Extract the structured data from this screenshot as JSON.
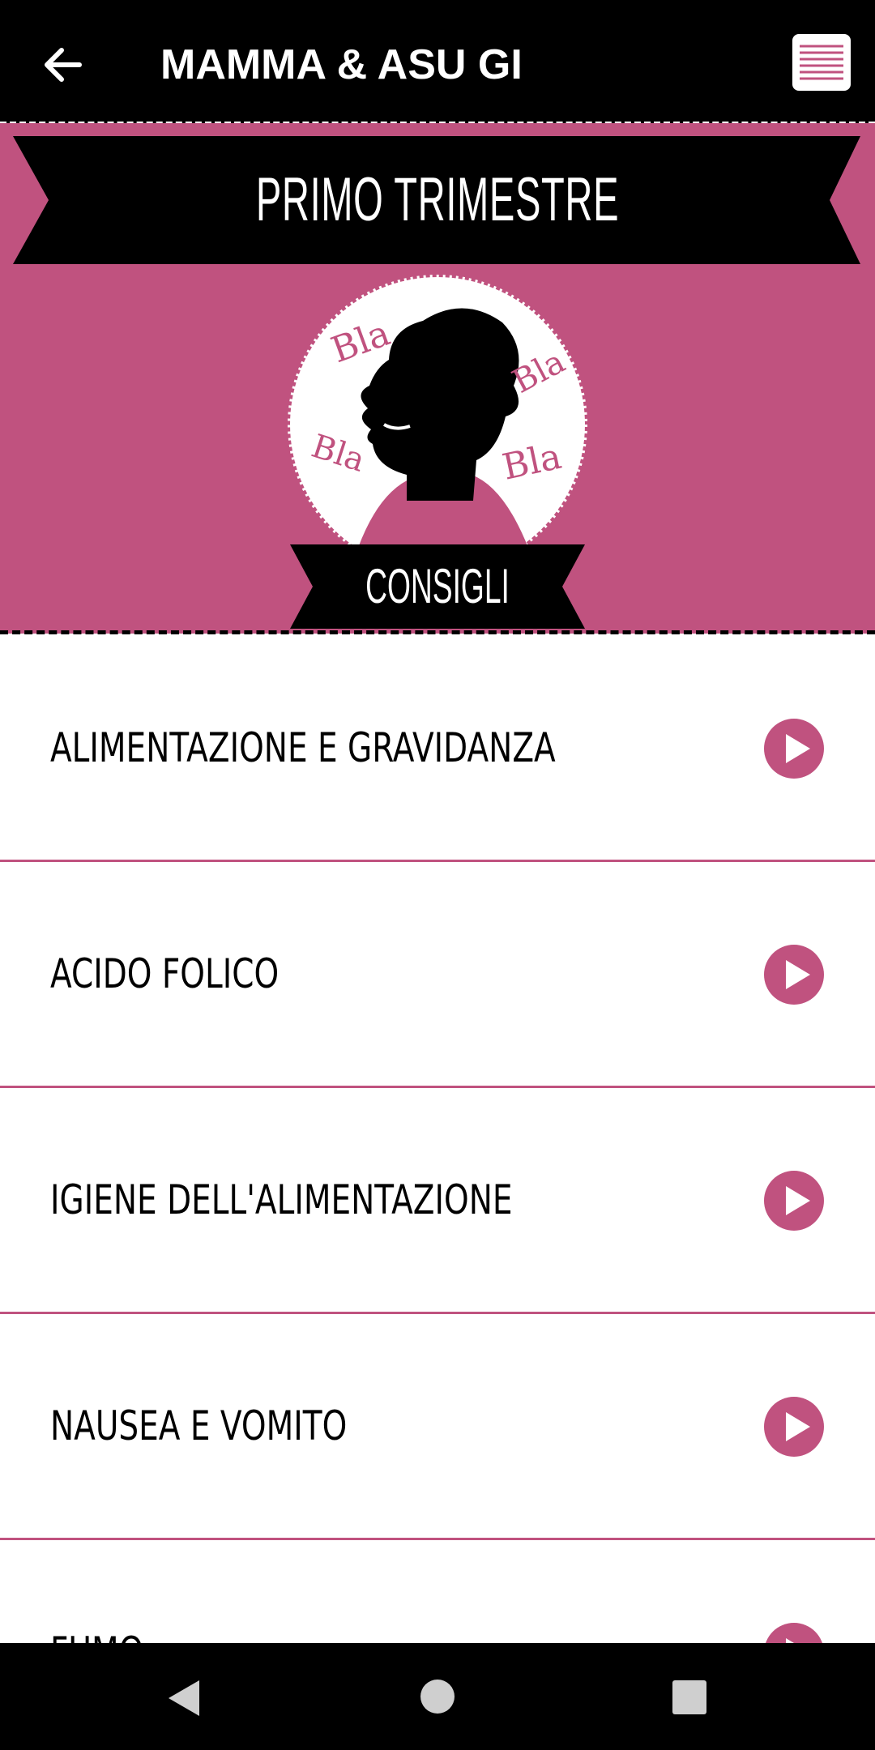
{
  "appbar": {
    "title": "MAMMA & ASU GI",
    "back_icon": "arrow-left-icon",
    "menu_icon": "menu-lines-icon"
  },
  "header": {
    "title": "PRIMO TRIMESTRE",
    "section_label": "CONSIGLI",
    "bubble_words": [
      "Bla",
      "Bla",
      "Bla",
      "Bla"
    ]
  },
  "list": {
    "items": [
      {
        "label": "ALIMENTAZIONE E GRAVIDANZA",
        "icon": "play-icon"
      },
      {
        "label": "ACIDO FOLICO",
        "icon": "play-icon"
      },
      {
        "label": "IGIENE DELL'ALIMENTAZIONE",
        "icon": "play-icon"
      },
      {
        "label": "NAUSEA E VOMITO",
        "icon": "play-icon"
      },
      {
        "label": "FUMO",
        "icon": "play-icon"
      }
    ]
  },
  "colors": {
    "accent": "#c0527f",
    "bar": "#000000",
    "text": "#000000"
  }
}
